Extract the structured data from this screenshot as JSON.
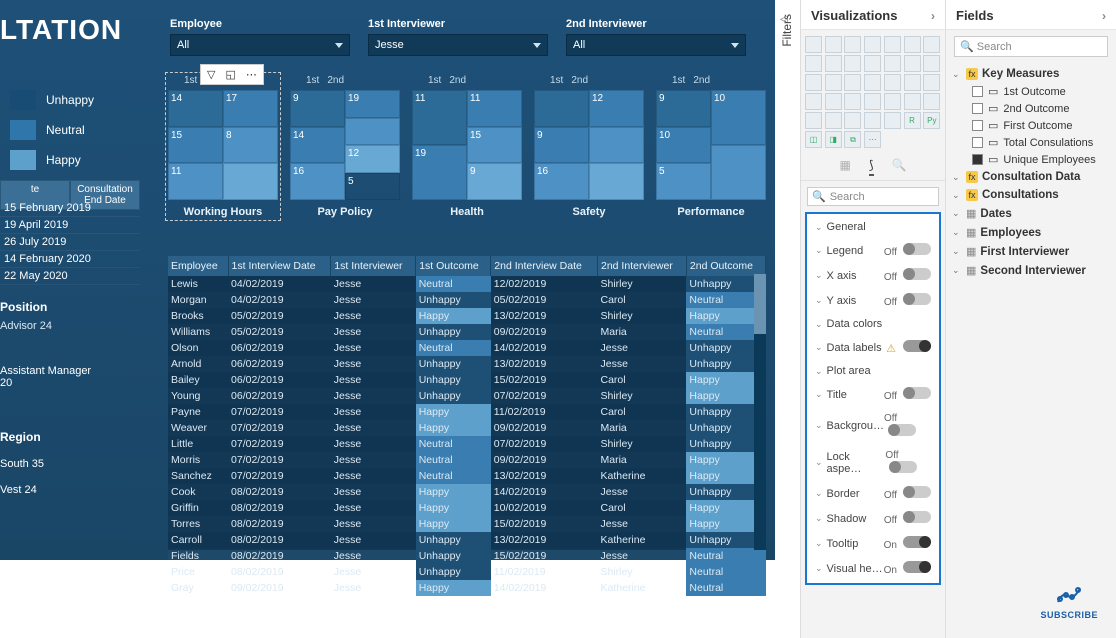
{
  "title": "LTATION",
  "slicers": [
    {
      "label": "Employee",
      "value": "All"
    },
    {
      "label": "1st Interviewer",
      "value": "Jesse"
    },
    {
      "label": "2nd Interviewer",
      "value": "All"
    }
  ],
  "legend": [
    "Unhappy",
    "Neutral",
    "Happy"
  ],
  "date_headers": [
    "te",
    "Consultation End Date"
  ],
  "dates": [
    "15 February 2019",
    "19 April 2019",
    "26 July 2019",
    "14 February 2020",
    "22 May 2020"
  ],
  "position": {
    "hd": "Position",
    "val": "Advisor 24"
  },
  "manager": {
    "line1": "Assistant Manager",
    "line2": "20"
  },
  "region": {
    "hd": "Region",
    "vals": [
      "South 35",
      "Vest 24"
    ]
  },
  "treemaps": [
    {
      "title": "Working Hours",
      "col1": [
        "14",
        "15",
        "11"
      ],
      "col2": [
        "17",
        "8",
        ""
      ]
    },
    {
      "title": "Pay Policy",
      "col1": [
        "9",
        "14",
        "16"
      ],
      "col2": [
        "19",
        "",
        "12",
        "5"
      ]
    },
    {
      "title": "Health",
      "col1": [
        "11",
        "19"
      ],
      "col2": [
        "11",
        "15",
        "9"
      ]
    },
    {
      "title": "Safety",
      "col1": [
        "",
        "9",
        "16"
      ],
      "col2": [
        "12",
        "",
        ""
      ]
    },
    {
      "title": "Performance",
      "col1": [
        "9",
        "10",
        "5"
      ],
      "col2": [
        "10",
        ""
      ]
    }
  ],
  "tree_cols": [
    "1st",
    "2nd"
  ],
  "table": {
    "headers": [
      "Employee",
      "1st Interview Date",
      "1st Interviewer",
      "1st Outcome",
      "2nd Interview Date",
      "2nd Interviewer",
      "2nd Outcome"
    ],
    "rows": [
      [
        "Lewis",
        "04/02/2019",
        "Jesse",
        "Neutral",
        "12/02/2019",
        "Shirley",
        "Unhappy"
      ],
      [
        "Morgan",
        "04/02/2019",
        "Jesse",
        "Unhappy",
        "05/02/2019",
        "Carol",
        "Neutral"
      ],
      [
        "Brooks",
        "05/02/2019",
        "Jesse",
        "Happy",
        "13/02/2019",
        "Shirley",
        "Happy"
      ],
      [
        "Williams",
        "05/02/2019",
        "Jesse",
        "Unhappy",
        "09/02/2019",
        "Maria",
        "Neutral"
      ],
      [
        "Olson",
        "06/02/2019",
        "Jesse",
        "Neutral",
        "14/02/2019",
        "Jesse",
        "Unhappy"
      ],
      [
        "Arnold",
        "06/02/2019",
        "Jesse",
        "Unhappy",
        "13/02/2019",
        "Jesse",
        "Unhappy"
      ],
      [
        "Bailey",
        "06/02/2019",
        "Jesse",
        "Unhappy",
        "15/02/2019",
        "Carol",
        "Happy"
      ],
      [
        "Young",
        "06/02/2019",
        "Jesse",
        "Unhappy",
        "07/02/2019",
        "Shirley",
        "Happy"
      ],
      [
        "Payne",
        "07/02/2019",
        "Jesse",
        "Happy",
        "11/02/2019",
        "Carol",
        "Unhappy"
      ],
      [
        "Weaver",
        "07/02/2019",
        "Jesse",
        "Happy",
        "09/02/2019",
        "Maria",
        "Unhappy"
      ],
      [
        "Little",
        "07/02/2019",
        "Jesse",
        "Neutral",
        "07/02/2019",
        "Shirley",
        "Unhappy"
      ],
      [
        "Morris",
        "07/02/2019",
        "Jesse",
        "Neutral",
        "09/02/2019",
        "Maria",
        "Happy"
      ],
      [
        "Sanchez",
        "07/02/2019",
        "Jesse",
        "Neutral",
        "13/02/2019",
        "Katherine",
        "Happy"
      ],
      [
        "Cook",
        "08/02/2019",
        "Jesse",
        "Happy",
        "14/02/2019",
        "Jesse",
        "Unhappy"
      ],
      [
        "Griffin",
        "08/02/2019",
        "Jesse",
        "Happy",
        "10/02/2019",
        "Carol",
        "Happy"
      ],
      [
        "Torres",
        "08/02/2019",
        "Jesse",
        "Happy",
        "15/02/2019",
        "Jesse",
        "Happy"
      ],
      [
        "Carroll",
        "08/02/2019",
        "Jesse",
        "Unhappy",
        "13/02/2019",
        "Katherine",
        "Unhappy"
      ],
      [
        "Fields",
        "08/02/2019",
        "Jesse",
        "Unhappy",
        "15/02/2019",
        "Jesse",
        "Neutral"
      ],
      [
        "Price",
        "08/02/2019",
        "Jesse",
        "Unhappy",
        "11/02/2019",
        "Shirley",
        "Neutral"
      ],
      [
        "Gray",
        "09/02/2019",
        "Jesse",
        "Happy",
        "14/02/2019",
        "Katherine",
        "Neutral"
      ]
    ]
  },
  "filters_label": "Filters",
  "panes": {
    "viz": "Visualizations",
    "fields": "Fields"
  },
  "viz_search": "Search",
  "fmt_sections": [
    {
      "name": "General",
      "state": ""
    },
    {
      "name": "Legend",
      "state": "Off"
    },
    {
      "name": "X axis",
      "state": "Off"
    },
    {
      "name": "Y axis",
      "state": "Off"
    },
    {
      "name": "Data colors",
      "state": ""
    },
    {
      "name": "Data labels",
      "state": "warn"
    },
    {
      "name": "Plot area",
      "state": ""
    },
    {
      "name": "Title",
      "state": "Off"
    },
    {
      "name": "Backgrou…",
      "state": "Off"
    },
    {
      "name": "Lock aspe…",
      "state": "Off"
    },
    {
      "name": "Border",
      "state": "Off"
    },
    {
      "name": "Shadow",
      "state": "Off"
    },
    {
      "name": "Tooltip",
      "state": "On"
    },
    {
      "name": "Visual he…",
      "state": "On"
    }
  ],
  "fields": {
    "search": "Search",
    "tables": [
      {
        "name": "Key Measures",
        "icon": "calc",
        "expanded": true,
        "children": [
          {
            "checked": false,
            "name": "1st Outcome"
          },
          {
            "checked": false,
            "name": "2nd Outcome"
          },
          {
            "checked": false,
            "name": "First Outcome"
          },
          {
            "checked": false,
            "name": "Total Consulations"
          },
          {
            "checked": true,
            "name": "Unique Employees"
          }
        ]
      },
      {
        "name": "Consultation Data",
        "icon": "calc"
      },
      {
        "name": "Consultations",
        "icon": "calc"
      },
      {
        "name": "Dates",
        "icon": "tbl"
      },
      {
        "name": "Employees",
        "icon": "tbl"
      },
      {
        "name": "First Interviewer",
        "icon": "tbl"
      },
      {
        "name": "Second Interviewer",
        "icon": "tbl"
      }
    ]
  },
  "subscribe": "SUBSCRIBE",
  "chart_data": [
    {
      "type": "treemap",
      "title": "Working Hours",
      "series": [
        {
          "name": "1st",
          "values": [
            14,
            15,
            11
          ]
        },
        {
          "name": "2nd",
          "values": [
            17,
            8
          ]
        }
      ]
    },
    {
      "type": "treemap",
      "title": "Pay Policy",
      "series": [
        {
          "name": "1st",
          "values": [
            9,
            14,
            16
          ]
        },
        {
          "name": "2nd",
          "values": [
            19,
            12,
            5
          ]
        }
      ]
    },
    {
      "type": "treemap",
      "title": "Health",
      "series": [
        {
          "name": "1st",
          "values": [
            11,
            19
          ]
        },
        {
          "name": "2nd",
          "values": [
            11,
            15,
            9
          ]
        }
      ]
    },
    {
      "type": "treemap",
      "title": "Safety",
      "series": [
        {
          "name": "1st",
          "values": [
            9,
            16
          ]
        },
        {
          "name": "2nd",
          "values": [
            12
          ]
        }
      ]
    },
    {
      "type": "treemap",
      "title": "Performance",
      "series": [
        {
          "name": "1st",
          "values": [
            9,
            10,
            5
          ]
        },
        {
          "name": "2nd",
          "values": [
            10
          ]
        }
      ]
    }
  ]
}
